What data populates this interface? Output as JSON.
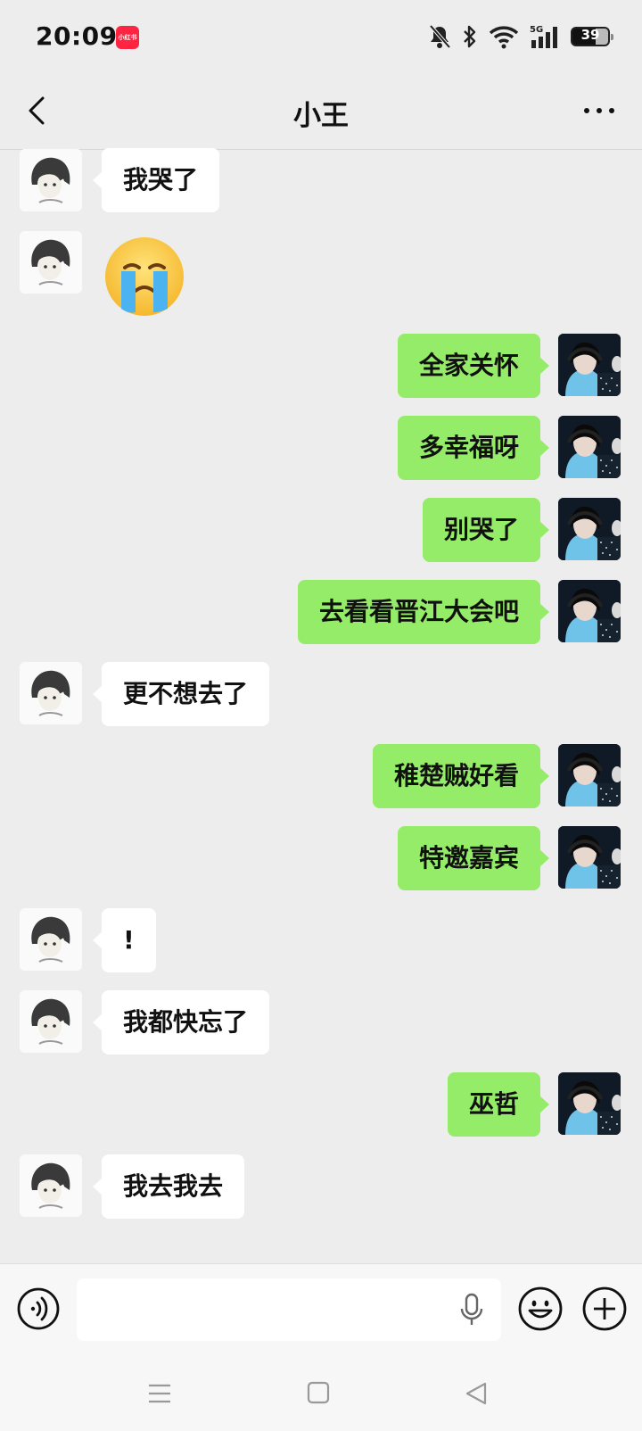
{
  "status_bar": {
    "time": "20:09",
    "app_badge": "小红书",
    "battery": "39",
    "icons": [
      "bell-off-icon",
      "bluetooth-icon",
      "wifi-icon",
      "5g-signal-icon",
      "battery-icon"
    ]
  },
  "header": {
    "title": "小王",
    "back_icon": "chevron-left-icon",
    "more_icon": "more-dots-icon"
  },
  "messages": [
    {
      "side": "left",
      "type": "text",
      "text": "我哭了"
    },
    {
      "side": "left",
      "type": "emoji",
      "emoji": "crying-face"
    },
    {
      "side": "right",
      "type": "text",
      "text": "全家关怀"
    },
    {
      "side": "right",
      "type": "text",
      "text": "多幸福呀"
    },
    {
      "side": "right",
      "type": "text",
      "text": "别哭了"
    },
    {
      "side": "right",
      "type": "text",
      "text": "去看看晋江大会吧"
    },
    {
      "side": "left",
      "type": "text",
      "text": "更不想去了"
    },
    {
      "side": "right",
      "type": "text",
      "text": "稚楚贼好看"
    },
    {
      "side": "right",
      "type": "text",
      "text": "特邀嘉宾"
    },
    {
      "side": "left",
      "type": "text",
      "text": "!"
    },
    {
      "side": "left",
      "type": "text",
      "text": "我都快忘了"
    },
    {
      "side": "right",
      "type": "text",
      "text": "巫哲"
    },
    {
      "side": "left",
      "type": "text",
      "text": "我去我去"
    }
  ],
  "input_bar": {
    "placeholder": "",
    "icons": [
      "voice-icon",
      "mic-icon",
      "emoji-icon",
      "plus-icon"
    ]
  },
  "colors": {
    "background": "#ededed",
    "bubble_right": "#95ec69",
    "bubble_left": "#ffffff",
    "badge": "#ff2442"
  }
}
